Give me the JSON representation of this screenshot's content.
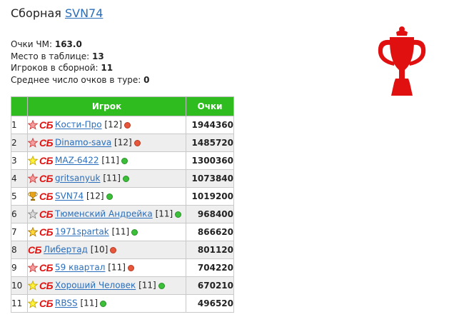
{
  "team": {
    "prefix": "Сборная",
    "name": "SVN74"
  },
  "stats": [
    {
      "label": "Очки ЧМ: ",
      "value": "163.0"
    },
    {
      "label": "Место в таблице: ",
      "value": "13"
    },
    {
      "label": "Игроков в сборной: ",
      "value": "11"
    },
    {
      "label": "Среднее число очков в туре: ",
      "value": "0"
    }
  ],
  "table": {
    "headers": {
      "rank": "",
      "player": "Игрок",
      "points": "Очки"
    },
    "badge_text": "СБ",
    "rows": [
      {
        "rank": "1",
        "icon": "star-red-icon",
        "name": "Кости-Про",
        "level": "[12]",
        "status": "red",
        "points": "1944360"
      },
      {
        "rank": "2",
        "icon": "star-red-icon",
        "name": "Dinamo-sava",
        "level": "[12]",
        "status": "red",
        "points": "1485720"
      },
      {
        "rank": "3",
        "icon": "star-yellow-icon",
        "name": "MAZ-6422",
        "level": "[11]",
        "status": "green",
        "points": "1300360"
      },
      {
        "rank": "4",
        "icon": "star-red-icon",
        "name": "gritsanyuk",
        "level": "[11]",
        "status": "green",
        "points": "1073840"
      },
      {
        "rank": "5",
        "icon": "trophy-icon",
        "name": "SVN74",
        "level": "[12]",
        "status": "green",
        "points": "1019200"
      },
      {
        "rank": "6",
        "icon": "star-gray-icon",
        "name": "Тюменский Андрейка",
        "level": "[11]",
        "status": "green",
        "points": "968400"
      },
      {
        "rank": "7",
        "icon": "star-gold-icon",
        "name": "1971spartak",
        "level": "[11]",
        "status": "green",
        "points": "866620"
      },
      {
        "rank": "8",
        "icon": "none",
        "name": "Либертад",
        "level": "[10]",
        "status": "red",
        "points": "801120"
      },
      {
        "rank": "9",
        "icon": "star-red-icon",
        "name": "59 квартал",
        "level": "[11]",
        "status": "red",
        "points": "704220"
      },
      {
        "rank": "10",
        "icon": "star-yellow-icon",
        "name": "Хороший Человек",
        "level": "[11]",
        "status": "green",
        "points": "670210"
      },
      {
        "rank": "11",
        "icon": "star-yellow-icon",
        "name": "RBSS",
        "level": "[11]",
        "status": "green",
        "points": "496520"
      }
    ]
  },
  "colors": {
    "header_green": "#2ebc1e",
    "link_blue": "#2a6ebb",
    "badge_red": "#e0120f",
    "cup_red": "#e01010"
  }
}
